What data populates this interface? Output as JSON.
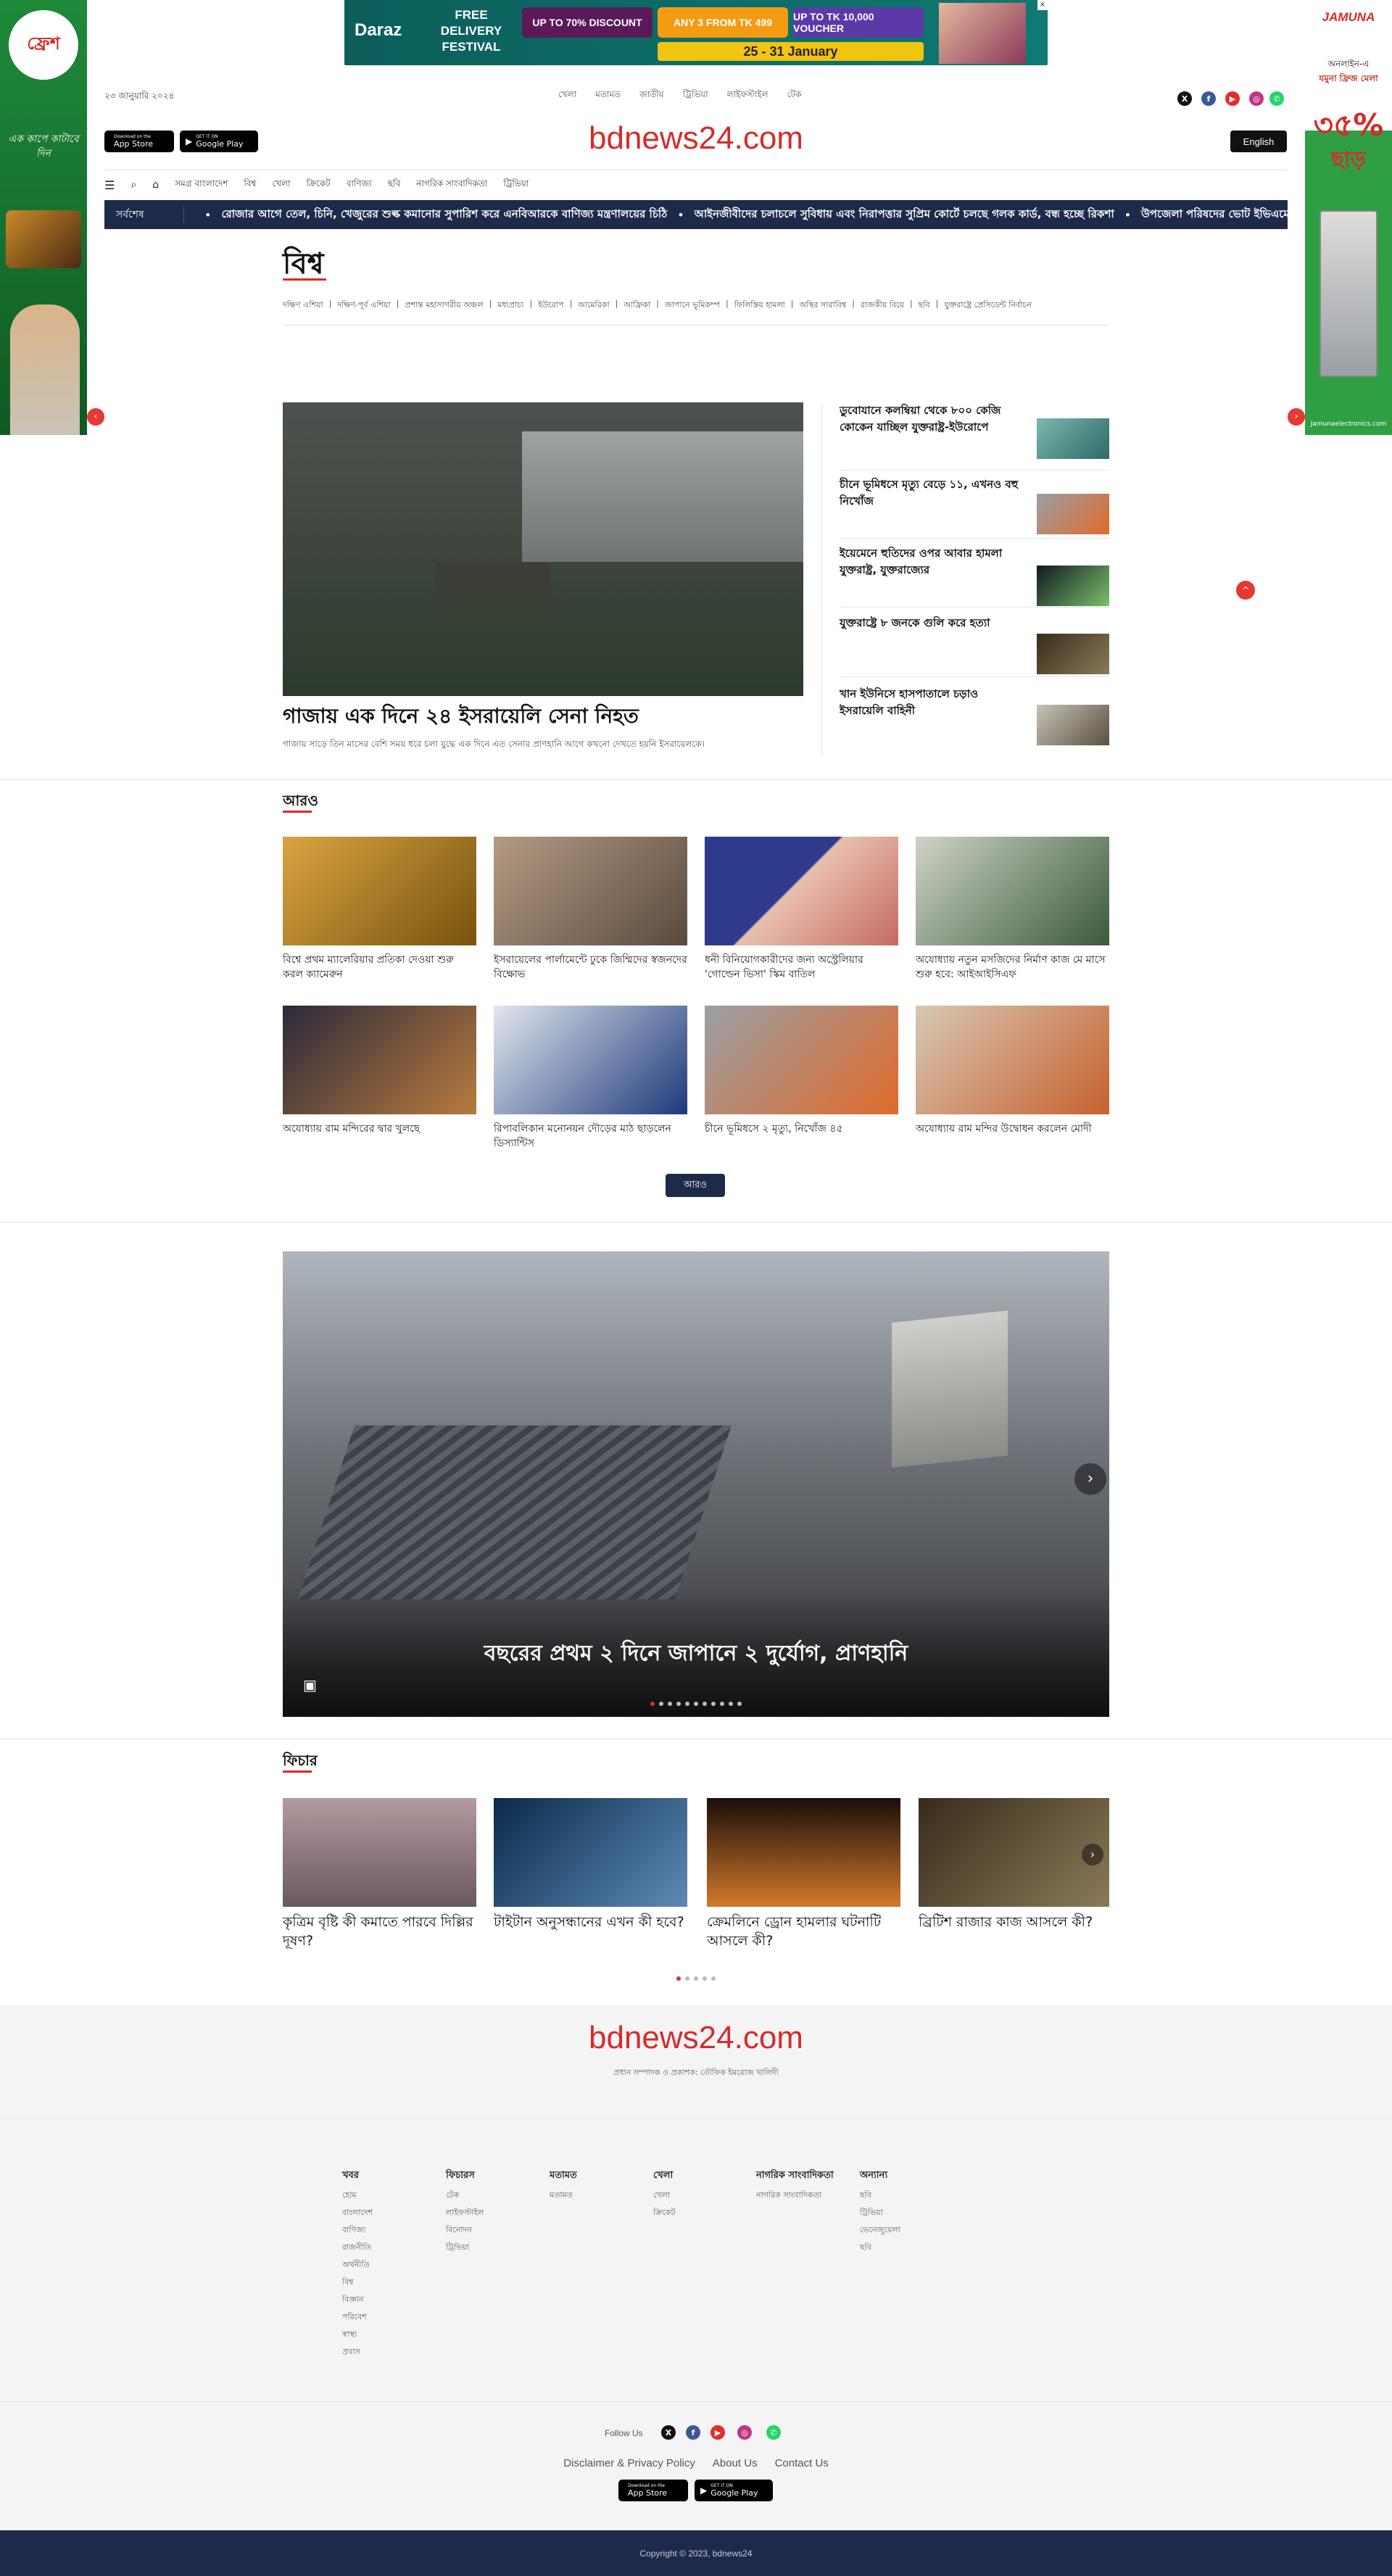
{
  "top_ad": {
    "brand": "Daraz",
    "headline": "FREE DELIVERY FESTIVAL",
    "offer_1": "UP TO 70% DISCOUNT",
    "offer_2": "ANY 3 FROM TK 499",
    "offer_3": "UP TO TK 10,000 VOUCHER",
    "dates": "25 - 31 January",
    "ad_tag": "Ad"
  },
  "left_ad": {
    "brand": "ফ্রেশ",
    "tagline": "এক কাপে কাটাবে দিন"
  },
  "right_ad": {
    "brand": "JAMUNA",
    "line_1": "অনলাইন-এ",
    "line_2": "যমুনা ফ্রিজ মেলা",
    "discount": "৩৫%",
    "discount_suffix": "ছাড়",
    "url": "Jamunaelectronics.com"
  },
  "header": {
    "date": "২৩ জানুয়ারি ২০২৪",
    "top_links": [
      "খেলা",
      "মতামত",
      "জাতীয়",
      "ট্রিভিয়া",
      "লাইফস্টাইল",
      "টেক"
    ],
    "logo": "bdnews24.com",
    "english_button": "English",
    "app_store": "App Store",
    "app_store_small": "Download on the",
    "google_play": "Google Play",
    "google_play_small": "GET IT ON"
  },
  "nav": {
    "items": [
      "সমগ্র বাংলাদেশ",
      "বিশ্ব",
      "খেলা",
      "ক্রিকেট",
      "বাণিজ্য",
      "ছবি",
      "নাগরিক সাংবাদিকতা",
      "ট্রিভিয়া"
    ]
  },
  "ticker": {
    "label": "সর্বশেষ",
    "items": [
      "রোজার আগে তেল, চিনি, খেজুরের শুল্ক কমানোর সুপারিশ করে এনবিআরকে বাণিজ্য মন্ত্রণালয়ের চিঠি",
      "আইনজীবীদের চলাচলে সুবিধায় এবং নিরাপত্তার সুপ্রিম কোর্টে চলছে গলক কার্ড, বন্ধ হচ্ছে রিকশা",
      "উপজেলা পরিষদের ভোট ইভিএমে"
    ]
  },
  "section": {
    "title": "বিশ্ব",
    "subnav": [
      "দক্ষিণ এশিয়া",
      "দক্ষিণ-পূর্ব এশিয়া",
      "প্রশান্ত মহাসাগরীয় অঞ্চল",
      "মধ্যপ্রাচ্য",
      "ইউরোপ",
      "আমেরিকা",
      "আফ্রিকা",
      "জাপানে ভূমিকম্প",
      "ফিলিস্তিয় হামলা",
      "অস্থির সারাবিশ্ব",
      "রাজকীয় বিয়ে",
      "ছবি",
      "যুক্তরাষ্ট্রে প্রেসিডেন্ট নির্বাচন"
    ]
  },
  "lead": {
    "headline": "গাজায় এক দিনে ২৪ ইসরায়েলি সেনা নিহত",
    "summary": "গাজায় সাড়ে তিন মাসের বেশি সময় ধরে চলা যুদ্ধে এক দিনে এত সেনার প্রাণহানি আগে কখনো দেখতে হয়নি ইসরায়েলকে।"
  },
  "side_stories": [
    {
      "title": "ডুবোযানে কলম্বিয়া থেকে ৮০০ কেজি কোকেন যাচ্ছিল যুক্তরাষ্ট্র-ইউরোপে"
    },
    {
      "title": "চীনে ভূমিধসে মৃত্যু বেড়ে ১১, এখনও বহু নিখোঁজ"
    },
    {
      "title": "ইয়েমেনে হুতিদের ওপর আবার হামলা যুক্তরাষ্ট্র, যুক্তরাজ্যের"
    },
    {
      "title": "যুক্তরাষ্ট্রে ৮ জনকে গুলি করে হত্যা"
    },
    {
      "title": "খান ইউনিসে হাসপাতালে চড়াও ইসরায়েলি বাহিনী"
    }
  ],
  "more": {
    "title": "আরও",
    "button": "আরও",
    "items": [
      {
        "title": "বিশ্বে প্রথম ম্যালেরিয়ার প্রতিকা দেওয়া শুরু করল ক্যামেরুন"
      },
      {
        "title": "ইসরায়েলের পার্লামেন্টে ঢুকে জিম্মিদের স্বজনদের বিক্ষোভ"
      },
      {
        "title": "ধনী বিনিয়োগকারীদের জন্য অস্ট্রেলিয়ার 'গোল্ডেন ভিসা' স্কিম বাতিল"
      },
      {
        "title": "অযোধ্যায় নতুন মসজিদের নির্মাণ কাজ মে মাসে শুরু হবে: আইআইসিএফ"
      },
      {
        "title": "অযোধ্যায় রাম মন্দিরের দ্বার খুলছে"
      },
      {
        "title": "রিপাবলিকান মনোনয়ন দৌড়ের মাঠ ছাড়লেন ডিস্যান্টিস"
      },
      {
        "title": "চীনে ভূমিধসে ২ মৃত্যু, নিখোঁজ ৪৫"
      },
      {
        "title": "অযোধ্যায় রাম মন্দির উদ্বোধন করলেন মোদী"
      }
    ]
  },
  "slider": {
    "caption": "বছরের প্রথম ২ দিনে জাপানে ২ দুর্যোগ, প্রাণহানি",
    "dots": 11,
    "active_dot": 0
  },
  "feature": {
    "title": "ফিচার",
    "items": [
      {
        "title": "কৃত্রিম বৃষ্টি কী কমাতে পারবে দিল্লির দূষণ?"
      },
      {
        "title": "টাইটান অনুসন্ধানের এখন কী হবে?"
      },
      {
        "title": "ক্রেমলিনে ড্রোন হামলার ঘটনাটি আসলে কী?"
      },
      {
        "title": "ব্রিটিশ রাজার কাজ আসলে কী?"
      }
    ],
    "dots": 5,
    "active_dot": 0
  },
  "footer": {
    "logo": "bdnews24.com",
    "editor": "প্রধান সম্পাদক ও প্রকাশক: তৌফিক ইমরোজ খালিদী",
    "columns": [
      {
        "head": "খবর",
        "links": [
          "হোম",
          "বাংলাদেশ",
          "বাণিজ্য",
          "রাজনীতি",
          "অর্থনীতি",
          "বিশ্ব",
          "বিজ্ঞান",
          "পরিবেশ",
          "স্বাস্থ্য",
          "প্রবাস"
        ]
      },
      {
        "head": "ফিচারস",
        "links": [
          "টেক",
          "লাইফস্টাইল",
          "বিনোদন",
          "ট্রিভিয়া"
        ]
      },
      {
        "head": "মতামত",
        "links": [
          "মতামত"
        ]
      },
      {
        "head": "খেলা",
        "links": [
          "খেলা",
          "ক্রিকেট"
        ]
      },
      {
        "head": "নাগরিক সাংবাদিকতা",
        "links": [
          "নাগরিক সাংবাদিকতা"
        ]
      },
      {
        "head": "অন্যান্য",
        "links": [
          "ছবি",
          "ট্রিভিয়া",
          "ভেনেজুয়েলা",
          "ছবি"
        ]
      }
    ],
    "follow_label": "Follow Us",
    "links": [
      "Disclaimer & Privacy Policy",
      "About Us",
      "Contact Us"
    ],
    "copyright": "Copyright © 2023, bdnews24"
  },
  "colors": {
    "brand_red": "#d62b2b",
    "navy": "#1e2a4a",
    "footer_bar": "#1e2a4a",
    "left_ad_green": "#1f8a3a",
    "right_ad_green": "#2ea043"
  }
}
